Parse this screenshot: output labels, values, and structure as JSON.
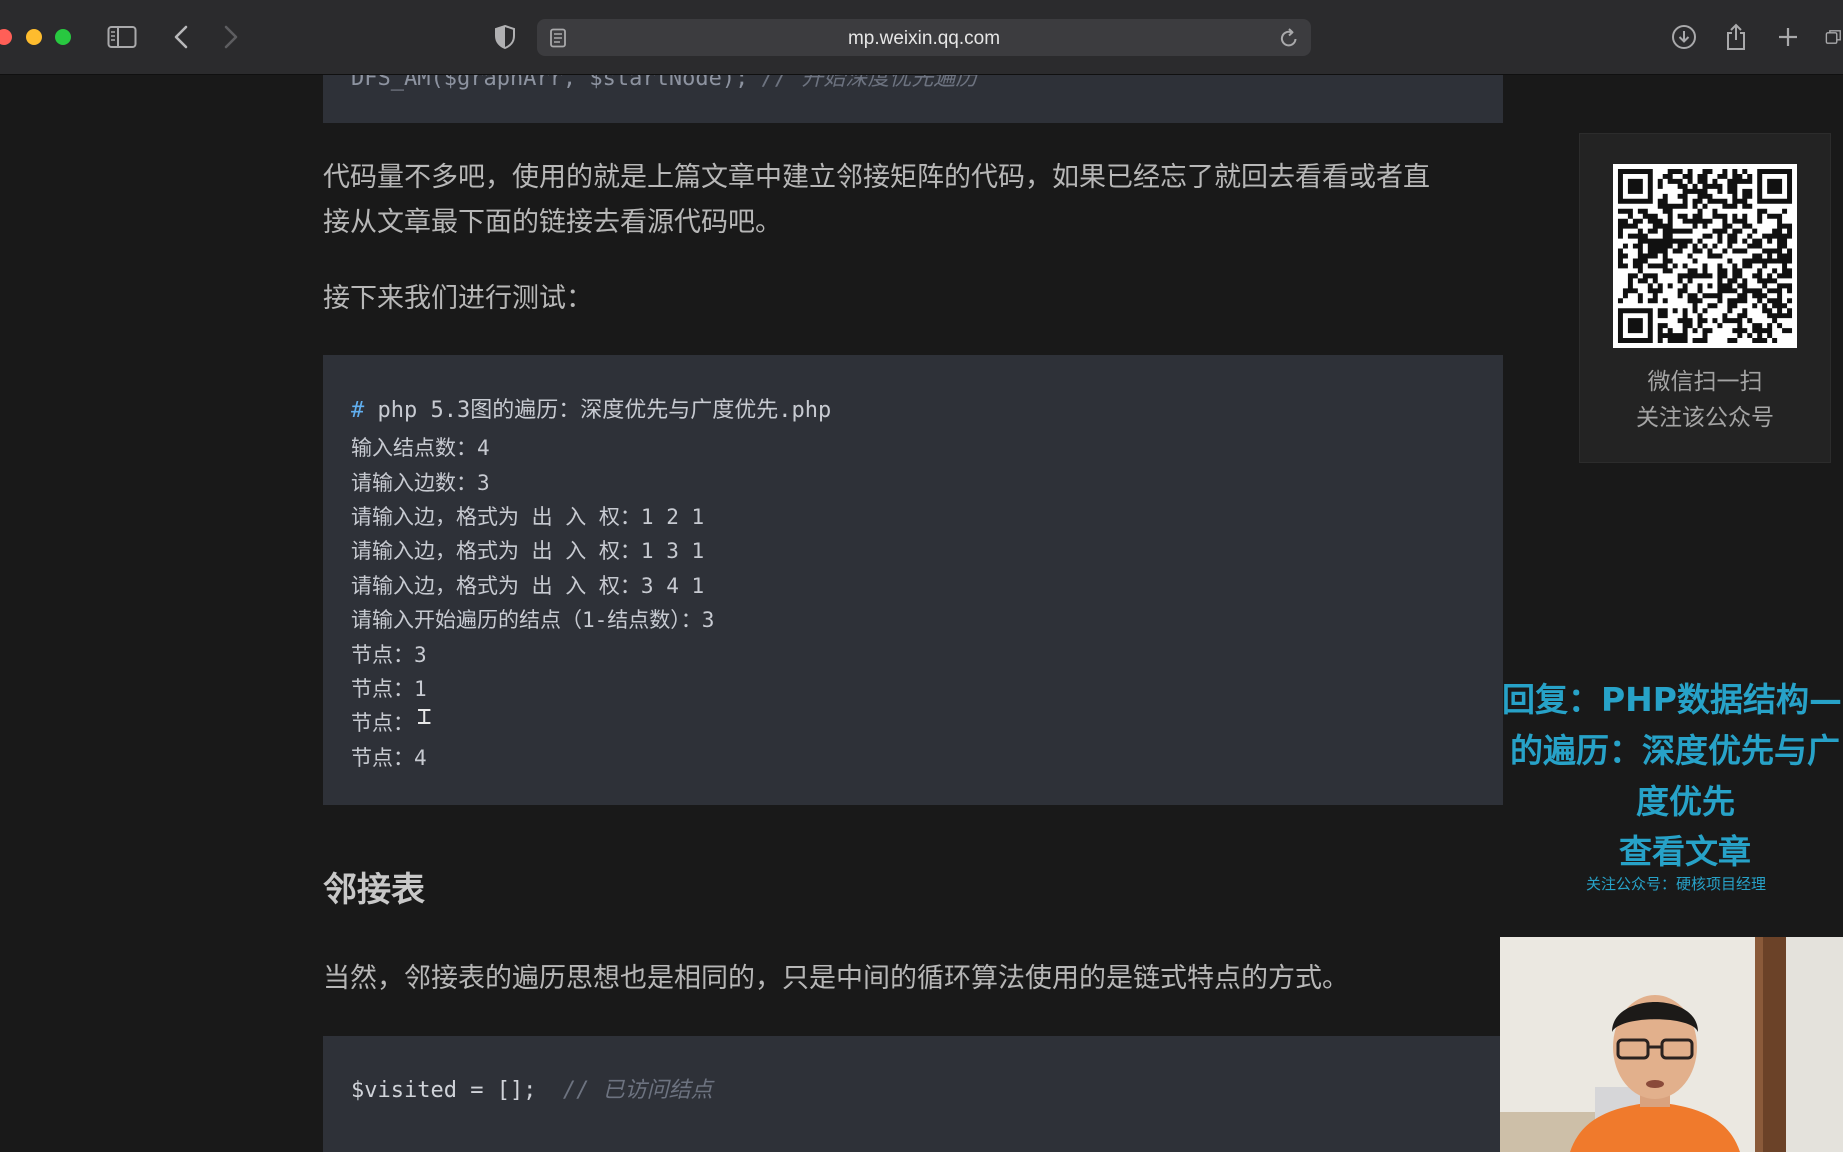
{
  "browser": {
    "url": "mp.weixin.qq.com"
  },
  "article": {
    "code_top_ghost": "DFS_AM($graphArr, $startNode); ",
    "code_top_ghost_comment": "// 开始深度优先遍历",
    "para1_line1": "代码量不多吧，使用的就是上篇文章中建立邻接矩阵的代码，如果已经忘了就回去看看或者直",
    "para1_line2": "接从文章最下面的链接去看源代码吧。",
    "para2": "接下来我们进行测试：",
    "code_block": {
      "hash": "#",
      "command": " php 5.3图的遍历：深度优先与广度优先.php",
      "lines": [
        "输入结点数：4",
        "请输入边数：3",
        "请输入边，格式为 出 入 权：1 2 1",
        "请输入边，格式为 出 入 权：1 3 1",
        "请输入边，格式为 出 入 权：3 4 1",
        "请输入开始遍历的结点（1-结点数）：3",
        "节点：3",
        "节点：1",
        "节点：",
        "节点：4"
      ]
    },
    "heading": "邻接表",
    "para3": "当然，邻接表的遍历思想也是相同的，只是中间的循环算法使用的是链式特点的方式。",
    "code_bottom_code": "$visited = [];  ",
    "code_bottom_comment": "// 已访问结点"
  },
  "sidebar": {
    "qr_caption_1": "微信扫一扫",
    "qr_caption_2": "关注该公众号"
  },
  "overlay": {
    "line1": "回复：PHP数据结构—",
    "line2": "的遍历：深度优先与广",
    "line3": "度优先",
    "line4": "查看文章",
    "small": "关注公众号：硬核项目经理"
  }
}
